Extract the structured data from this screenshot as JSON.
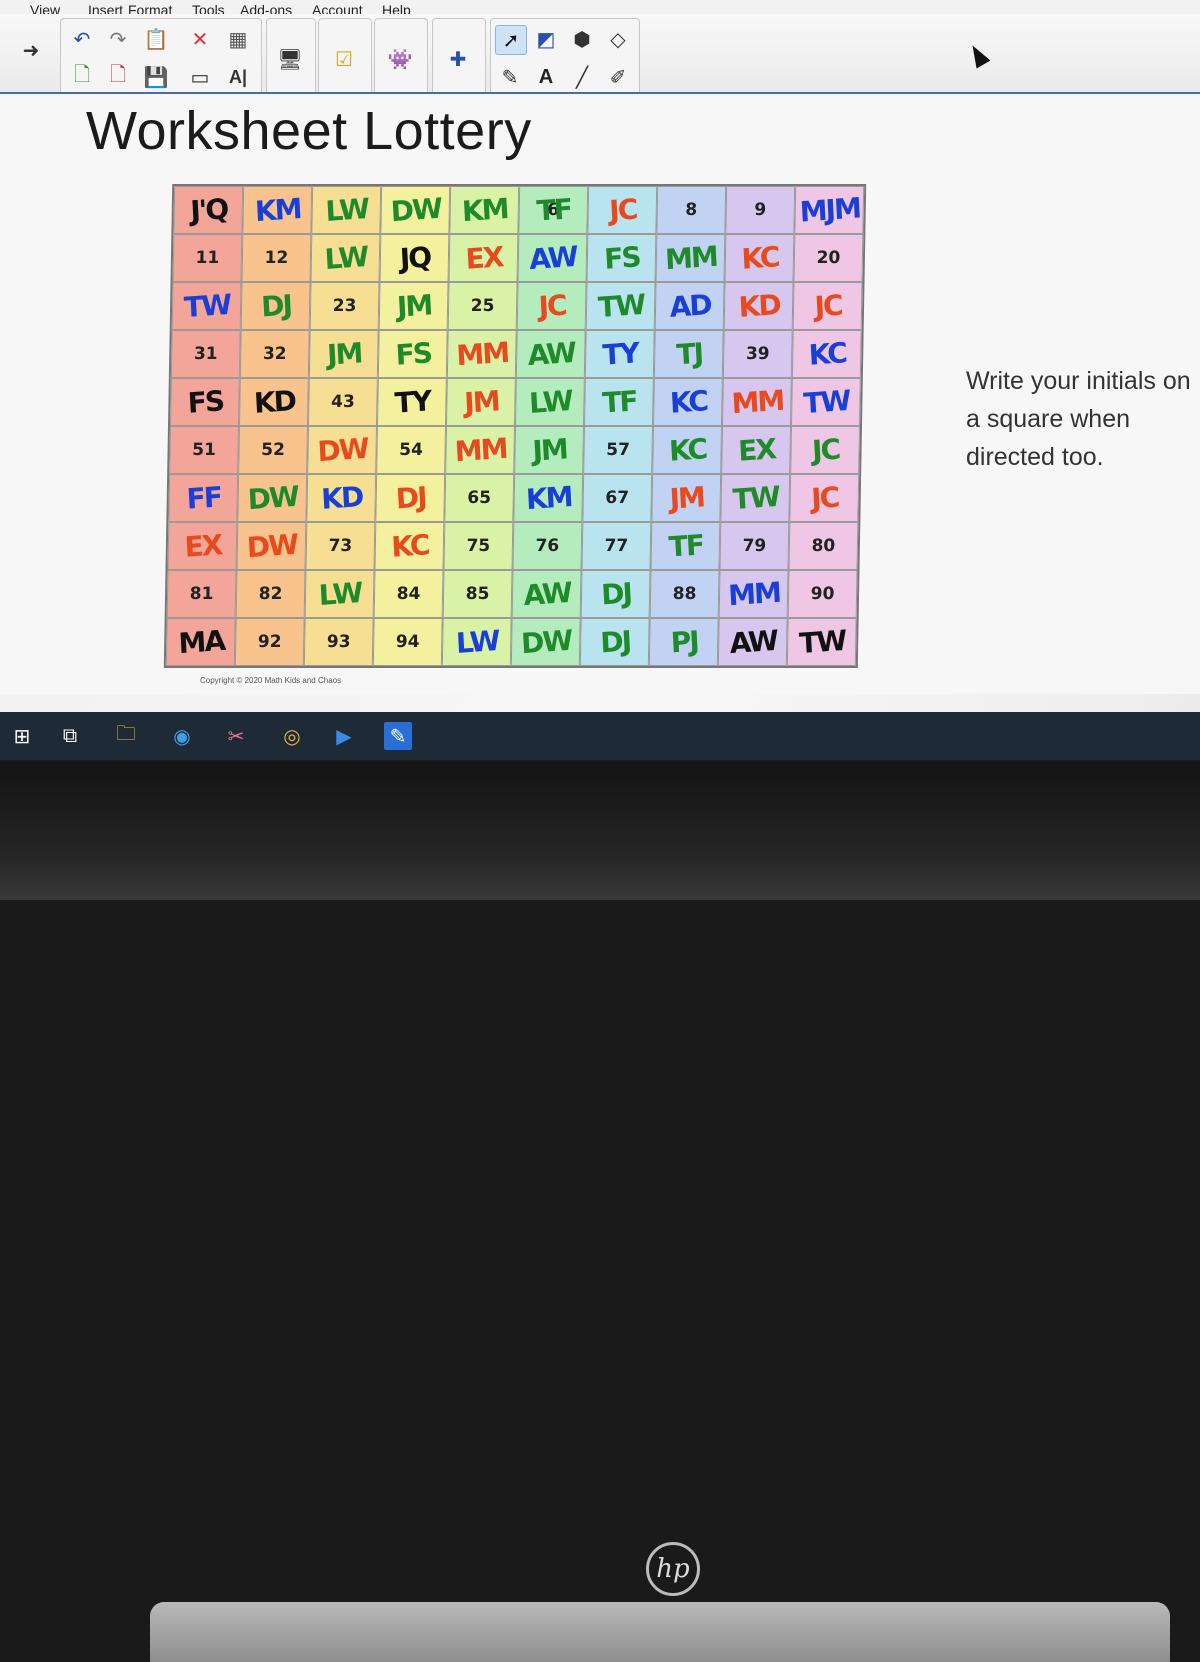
{
  "menu": [
    "View",
    "Insert",
    "Format",
    "Tools",
    "Add-ons",
    "Account",
    "Help"
  ],
  "toolbar": {
    "icons": [
      "forward-arrow-icon",
      "undo-icon",
      "redo-icon",
      "paste-icon",
      "delete-icon",
      "table-icon",
      "new-page-icon",
      "delete-page-icon",
      "save-icon",
      "screen-icon",
      "text-recognition-icon",
      "document-camera-icon",
      "capture-icon",
      "activity-icon",
      "extension-icon",
      "select-icon",
      "shape-icon",
      "fill-icon",
      "eraser-icon",
      "pen-icon",
      "text-icon",
      "line-icon",
      "highlighter-icon"
    ],
    "text_label": "A",
    "ai_label": "A|"
  },
  "slide": {
    "title": "Worksheet Lottery",
    "side_text": "Write your initials on a square when directed too.",
    "copyright": "Copyright © 2020 Math Kids and Chaos"
  },
  "grid": {
    "rows": [
      [
        {
          "n": "",
          "i": "J'Q",
          "c": "#111"
        },
        {
          "n": "",
          "i": "KM",
          "c": "#1a3fd6"
        },
        {
          "n": "",
          "i": "LW",
          "c": "#1e8a2a"
        },
        {
          "n": "",
          "i": "DW",
          "c": "#1e8a2a"
        },
        {
          "n": "",
          "i": "KM",
          "c": "#1e8a2a"
        },
        {
          "n": "6",
          "i": "TF",
          "c": "#1e8a2a"
        },
        {
          "n": "",
          "i": "JC",
          "c": "#e84a1e"
        },
        {
          "n": "8",
          "i": "",
          "c": ""
        },
        {
          "n": "9",
          "i": "",
          "c": ""
        },
        {
          "n": "",
          "i": "MJM",
          "c": "#1a3fd6"
        }
      ],
      [
        {
          "n": "11",
          "i": "",
          "c": ""
        },
        {
          "n": "12",
          "i": "",
          "c": ""
        },
        {
          "n": "",
          "i": "LW",
          "c": "#1e8a2a"
        },
        {
          "n": "",
          "i": "JQ",
          "c": "#111"
        },
        {
          "n": "",
          "i": "EX",
          "c": "#e84a1e"
        },
        {
          "n": "",
          "i": "AW",
          "c": "#1a3fd6"
        },
        {
          "n": "",
          "i": "FS",
          "c": "#1e8a2a"
        },
        {
          "n": "",
          "i": "MM",
          "c": "#1e8a2a"
        },
        {
          "n": "",
          "i": "KC",
          "c": "#e84a1e"
        },
        {
          "n": "20",
          "i": "",
          "c": ""
        }
      ],
      [
        {
          "n": "",
          "i": "TW",
          "c": "#1a3fd6"
        },
        {
          "n": "",
          "i": "DJ",
          "c": "#1e8a2a"
        },
        {
          "n": "23",
          "i": "",
          "c": ""
        },
        {
          "n": "",
          "i": "JM",
          "c": "#1e8a2a"
        },
        {
          "n": "25",
          "i": "",
          "c": ""
        },
        {
          "n": "",
          "i": "JC",
          "c": "#e84a1e"
        },
        {
          "n": "",
          "i": "TW",
          "c": "#1e8a2a"
        },
        {
          "n": "",
          "i": "AD",
          "c": "#1a3fd6"
        },
        {
          "n": "",
          "i": "KD",
          "c": "#e84a1e"
        },
        {
          "n": "",
          "i": "JC",
          "c": "#e84a1e"
        }
      ],
      [
        {
          "n": "31",
          "i": "",
          "c": ""
        },
        {
          "n": "32",
          "i": "",
          "c": ""
        },
        {
          "n": "",
          "i": "JM",
          "c": "#1e8a2a"
        },
        {
          "n": "",
          "i": "FS",
          "c": "#1e8a2a"
        },
        {
          "n": "",
          "i": "MM",
          "c": "#e84a1e"
        },
        {
          "n": "",
          "i": "AW",
          "c": "#1e8a2a"
        },
        {
          "n": "",
          "i": "TY",
          "c": "#1a3fd6"
        },
        {
          "n": "",
          "i": "TJ",
          "c": "#1e8a2a"
        },
        {
          "n": "39",
          "i": "",
          "c": ""
        },
        {
          "n": "",
          "i": "KC",
          "c": "#1a3fd6"
        }
      ],
      [
        {
          "n": "",
          "i": "FS",
          "c": "#111"
        },
        {
          "n": "",
          "i": "KD",
          "c": "#111"
        },
        {
          "n": "43",
          "i": "",
          "c": ""
        },
        {
          "n": "",
          "i": "TY",
          "c": "#111"
        },
        {
          "n": "",
          "i": "JM",
          "c": "#e84a1e"
        },
        {
          "n": "",
          "i": "LW",
          "c": "#1e8a2a"
        },
        {
          "n": "",
          "i": "TF",
          "c": "#1e8a2a"
        },
        {
          "n": "",
          "i": "KC",
          "c": "#1a3fd6"
        },
        {
          "n": "",
          "i": "MM",
          "c": "#e84a1e"
        },
        {
          "n": "",
          "i": "TW",
          "c": "#1a3fd6"
        }
      ],
      [
        {
          "n": "51",
          "i": "",
          "c": ""
        },
        {
          "n": "52",
          "i": "",
          "c": ""
        },
        {
          "n": "",
          "i": "DW",
          "c": "#e84a1e"
        },
        {
          "n": "54",
          "i": "",
          "c": ""
        },
        {
          "n": "",
          "i": "MM",
          "c": "#e84a1e"
        },
        {
          "n": "",
          "i": "JM",
          "c": "#1e8a2a"
        },
        {
          "n": "57",
          "i": "",
          "c": ""
        },
        {
          "n": "",
          "i": "KC",
          "c": "#1e8a2a"
        },
        {
          "n": "",
          "i": "EX",
          "c": "#1e8a2a"
        },
        {
          "n": "",
          "i": "JC",
          "c": "#1e8a2a"
        }
      ],
      [
        {
          "n": "",
          "i": "FF",
          "c": "#1a3fd6"
        },
        {
          "n": "",
          "i": "DW",
          "c": "#1e8a2a"
        },
        {
          "n": "",
          "i": "KD",
          "c": "#1a3fd6"
        },
        {
          "n": "",
          "i": "DJ",
          "c": "#e84a1e"
        },
        {
          "n": "65",
          "i": "",
          "c": ""
        },
        {
          "n": "",
          "i": "KM",
          "c": "#1a3fd6"
        },
        {
          "n": "67",
          "i": "",
          "c": ""
        },
        {
          "n": "",
          "i": "JM",
          "c": "#e84a1e"
        },
        {
          "n": "",
          "i": "TW",
          "c": "#1e8a2a"
        },
        {
          "n": "",
          "i": "JC",
          "c": "#e84a1e"
        }
      ],
      [
        {
          "n": "",
          "i": "EX",
          "c": "#e84a1e"
        },
        {
          "n": "",
          "i": "DW",
          "c": "#e84a1e"
        },
        {
          "n": "73",
          "i": "",
          "c": ""
        },
        {
          "n": "",
          "i": "KC",
          "c": "#e84a1e"
        },
        {
          "n": "75",
          "i": "",
          "c": ""
        },
        {
          "n": "76",
          "i": "",
          "c": ""
        },
        {
          "n": "77",
          "i": "",
          "c": ""
        },
        {
          "n": "",
          "i": "TF",
          "c": "#1e8a2a"
        },
        {
          "n": "79",
          "i": "",
          "c": ""
        },
        {
          "n": "80",
          "i": "",
          "c": ""
        }
      ],
      [
        {
          "n": "81",
          "i": "",
          "c": ""
        },
        {
          "n": "82",
          "i": "",
          "c": ""
        },
        {
          "n": "",
          "i": "LW",
          "c": "#1e8a2a"
        },
        {
          "n": "84",
          "i": "",
          "c": ""
        },
        {
          "n": "85",
          "i": "",
          "c": ""
        },
        {
          "n": "",
          "i": "AW",
          "c": "#1e8a2a"
        },
        {
          "n": "",
          "i": "DJ",
          "c": "#1e8a2a"
        },
        {
          "n": "88",
          "i": "",
          "c": ""
        },
        {
          "n": "",
          "i": "MM",
          "c": "#1a3fd6"
        },
        {
          "n": "90",
          "i": "",
          "c": ""
        }
      ],
      [
        {
          "n": "",
          "i": "MA",
          "c": "#111"
        },
        {
          "n": "92",
          "i": "",
          "c": ""
        },
        {
          "n": "93",
          "i": "",
          "c": ""
        },
        {
          "n": "94",
          "i": "",
          "c": ""
        },
        {
          "n": "",
          "i": "LW",
          "c": "#1a3fd6"
        },
        {
          "n": "",
          "i": "DW",
          "c": "#1e8a2a"
        },
        {
          "n": "",
          "i": "DJ",
          "c": "#1e8a2a"
        },
        {
          "n": "",
          "i": "PJ",
          "c": "#1e8a2a"
        },
        {
          "n": "",
          "i": "AW",
          "c": "#111"
        },
        {
          "n": "",
          "i": "TW",
          "c": "#111"
        }
      ]
    ]
  },
  "taskbar": {
    "icons": [
      "windows-start-icon",
      "task-view-icon",
      "file-explorer-icon",
      "edge-icon",
      "snip-icon",
      "chrome-icon",
      "zoom-icon",
      "notebook-app-icon"
    ]
  },
  "laptop": {
    "brand": "hp"
  }
}
